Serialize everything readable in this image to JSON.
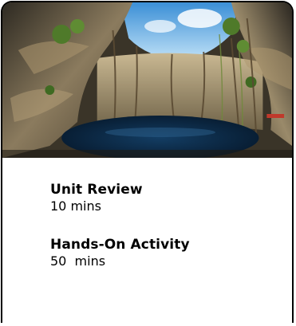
{
  "card": {
    "image_alt": "Cenote cave photograph",
    "items": [
      {
        "title": "Unit Review",
        "duration": "10 mins"
      },
      {
        "title": "Hands-On Activity",
        "duration": "50  mins"
      }
    ]
  },
  "colors": {
    "border": "#000000",
    "text": "#000000",
    "water": "#0b2a4a",
    "sky": "#6fb4e8",
    "rock": "#7a6a52",
    "foliage": "#4f7a2a"
  }
}
